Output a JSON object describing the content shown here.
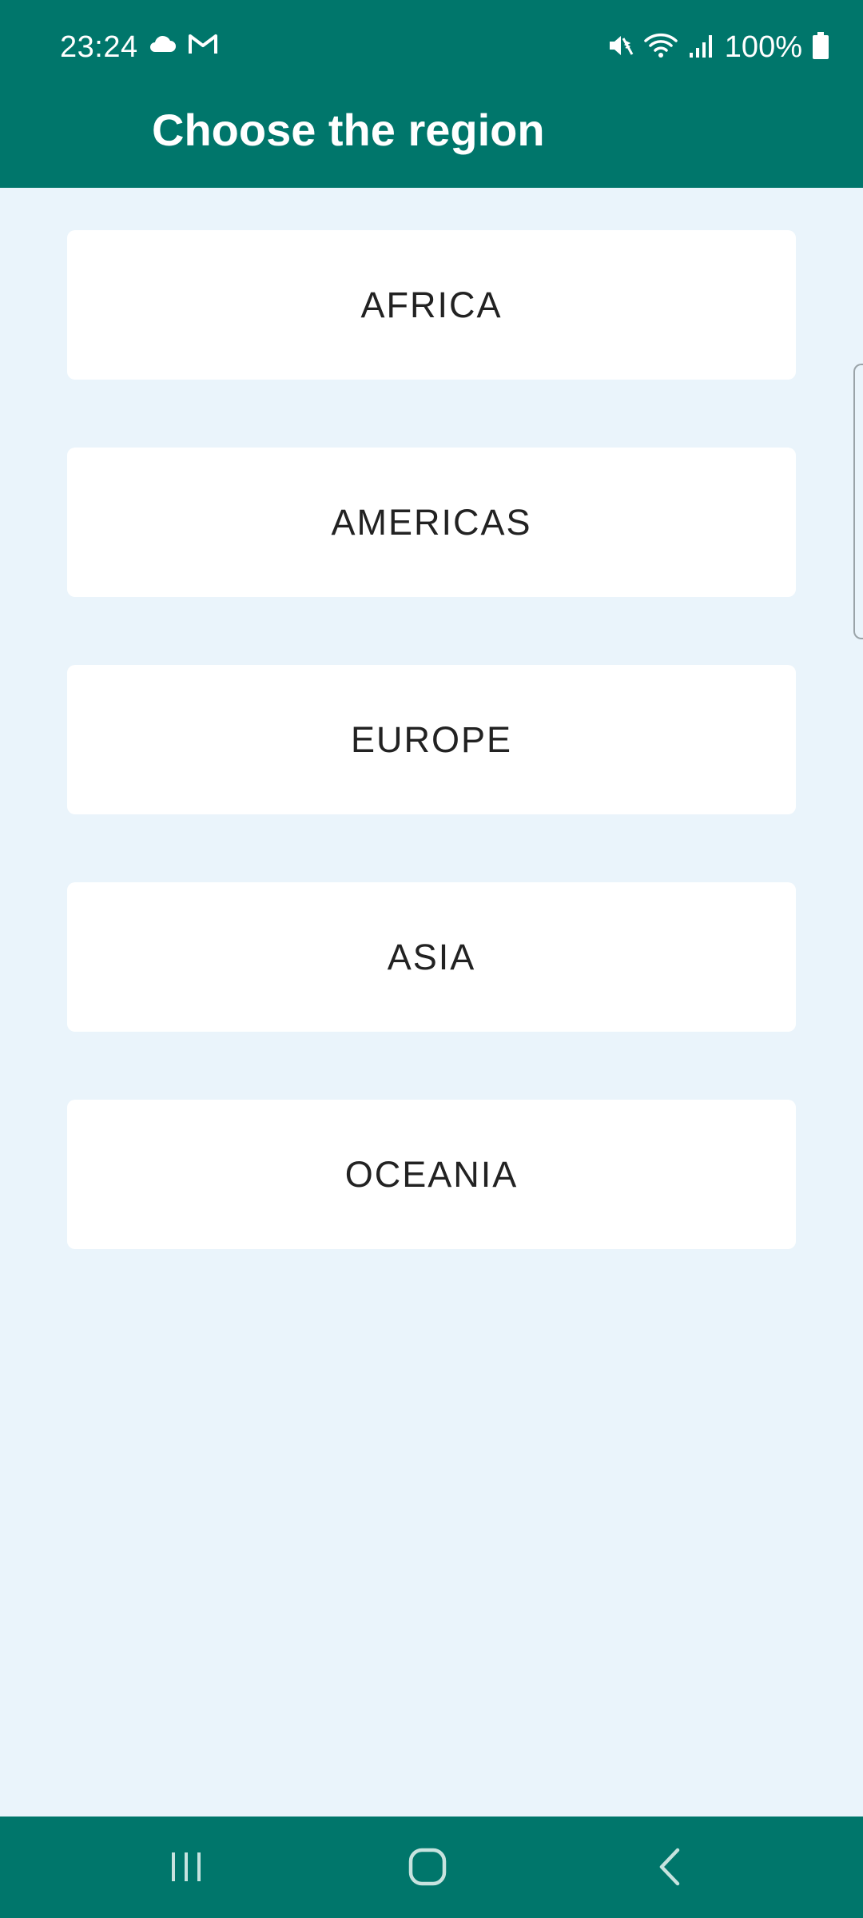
{
  "status_bar": {
    "time": "23:24",
    "battery": "100%",
    "left_icons": [
      "cloud-icon",
      "gmail-icon"
    ],
    "right_icons": [
      "mute-icon",
      "wifi-icon",
      "signal-icon",
      "battery-icon"
    ]
  },
  "app_bar": {
    "title": "Choose the region"
  },
  "regions": [
    {
      "label": "AFRICA"
    },
    {
      "label": "AMERICAS"
    },
    {
      "label": "EUROPE"
    },
    {
      "label": "ASIA"
    },
    {
      "label": "OCEANIA"
    }
  ],
  "nav_bar": {
    "buttons": [
      "recents-icon",
      "home-icon",
      "back-icon"
    ]
  },
  "colors": {
    "header": "#00766b",
    "background": "#eaf4fb",
    "card": "#ffffff",
    "text": "#222222"
  }
}
